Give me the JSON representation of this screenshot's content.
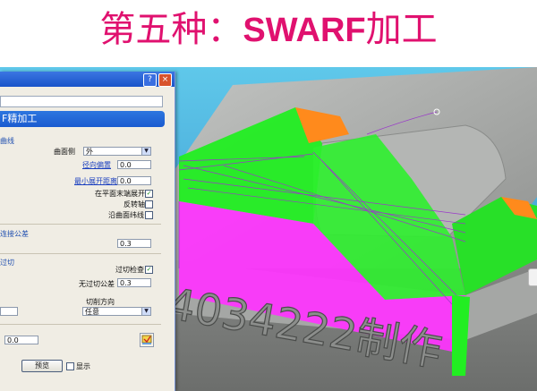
{
  "slide": {
    "title_cn_1": "第五种：",
    "title_en": "SWARF",
    "title_cn_2": "加工"
  },
  "dialog": {
    "title_buttons": {
      "help": "?",
      "close": "×"
    },
    "banner": "F精加工",
    "section_surface": "曲线",
    "surface_side_label": "曲面侧",
    "surface_side_value": "外",
    "radial_offset_label": "径向偏置",
    "radial_offset_value": "0.0",
    "min_unfold_label": "最小展开距离",
    "min_unfold_value": "0.0",
    "unfold_ends_label": "在平面末端展开",
    "reverse_axis_label": "反转轴",
    "along_surface_label": "沿曲面纬线",
    "section_connect_tol": "连接公差",
    "connect_tol_value": "0.3",
    "section_overcut": "过切",
    "overcut_check_label": "过切检查",
    "no_overcut_tol_label": "无过切公差",
    "no_overcut_tol_value": "0.3",
    "cut_direction_label": "切削方向",
    "cut_direction_value": "任意",
    "thickness_value": "0.0",
    "preview_label": "预览",
    "display_label": "显示"
  },
  "scene": {
    "engraved_text": "4034222制作"
  }
}
